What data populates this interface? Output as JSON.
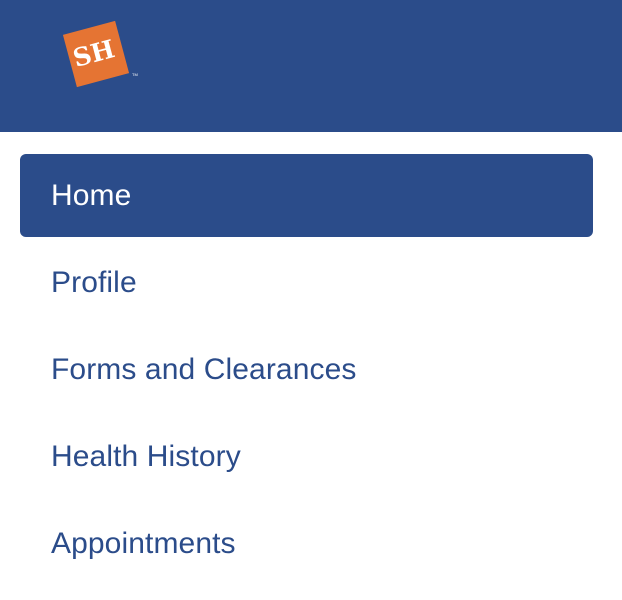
{
  "brand": {
    "logo_text": "SH",
    "logo_trademark": "TM",
    "colors": {
      "header": "#2b4c8a",
      "accent": "#e57433",
      "text_active": "#ffffff",
      "text_nav": "#2b4c8a"
    }
  },
  "nav": {
    "items": [
      {
        "label": "Home",
        "state": "active"
      },
      {
        "label": "Profile",
        "state": "default"
      },
      {
        "label": "Forms and Clearances",
        "state": "default"
      },
      {
        "label": "Health History",
        "state": "default"
      },
      {
        "label": "Appointments",
        "state": "default"
      }
    ]
  }
}
